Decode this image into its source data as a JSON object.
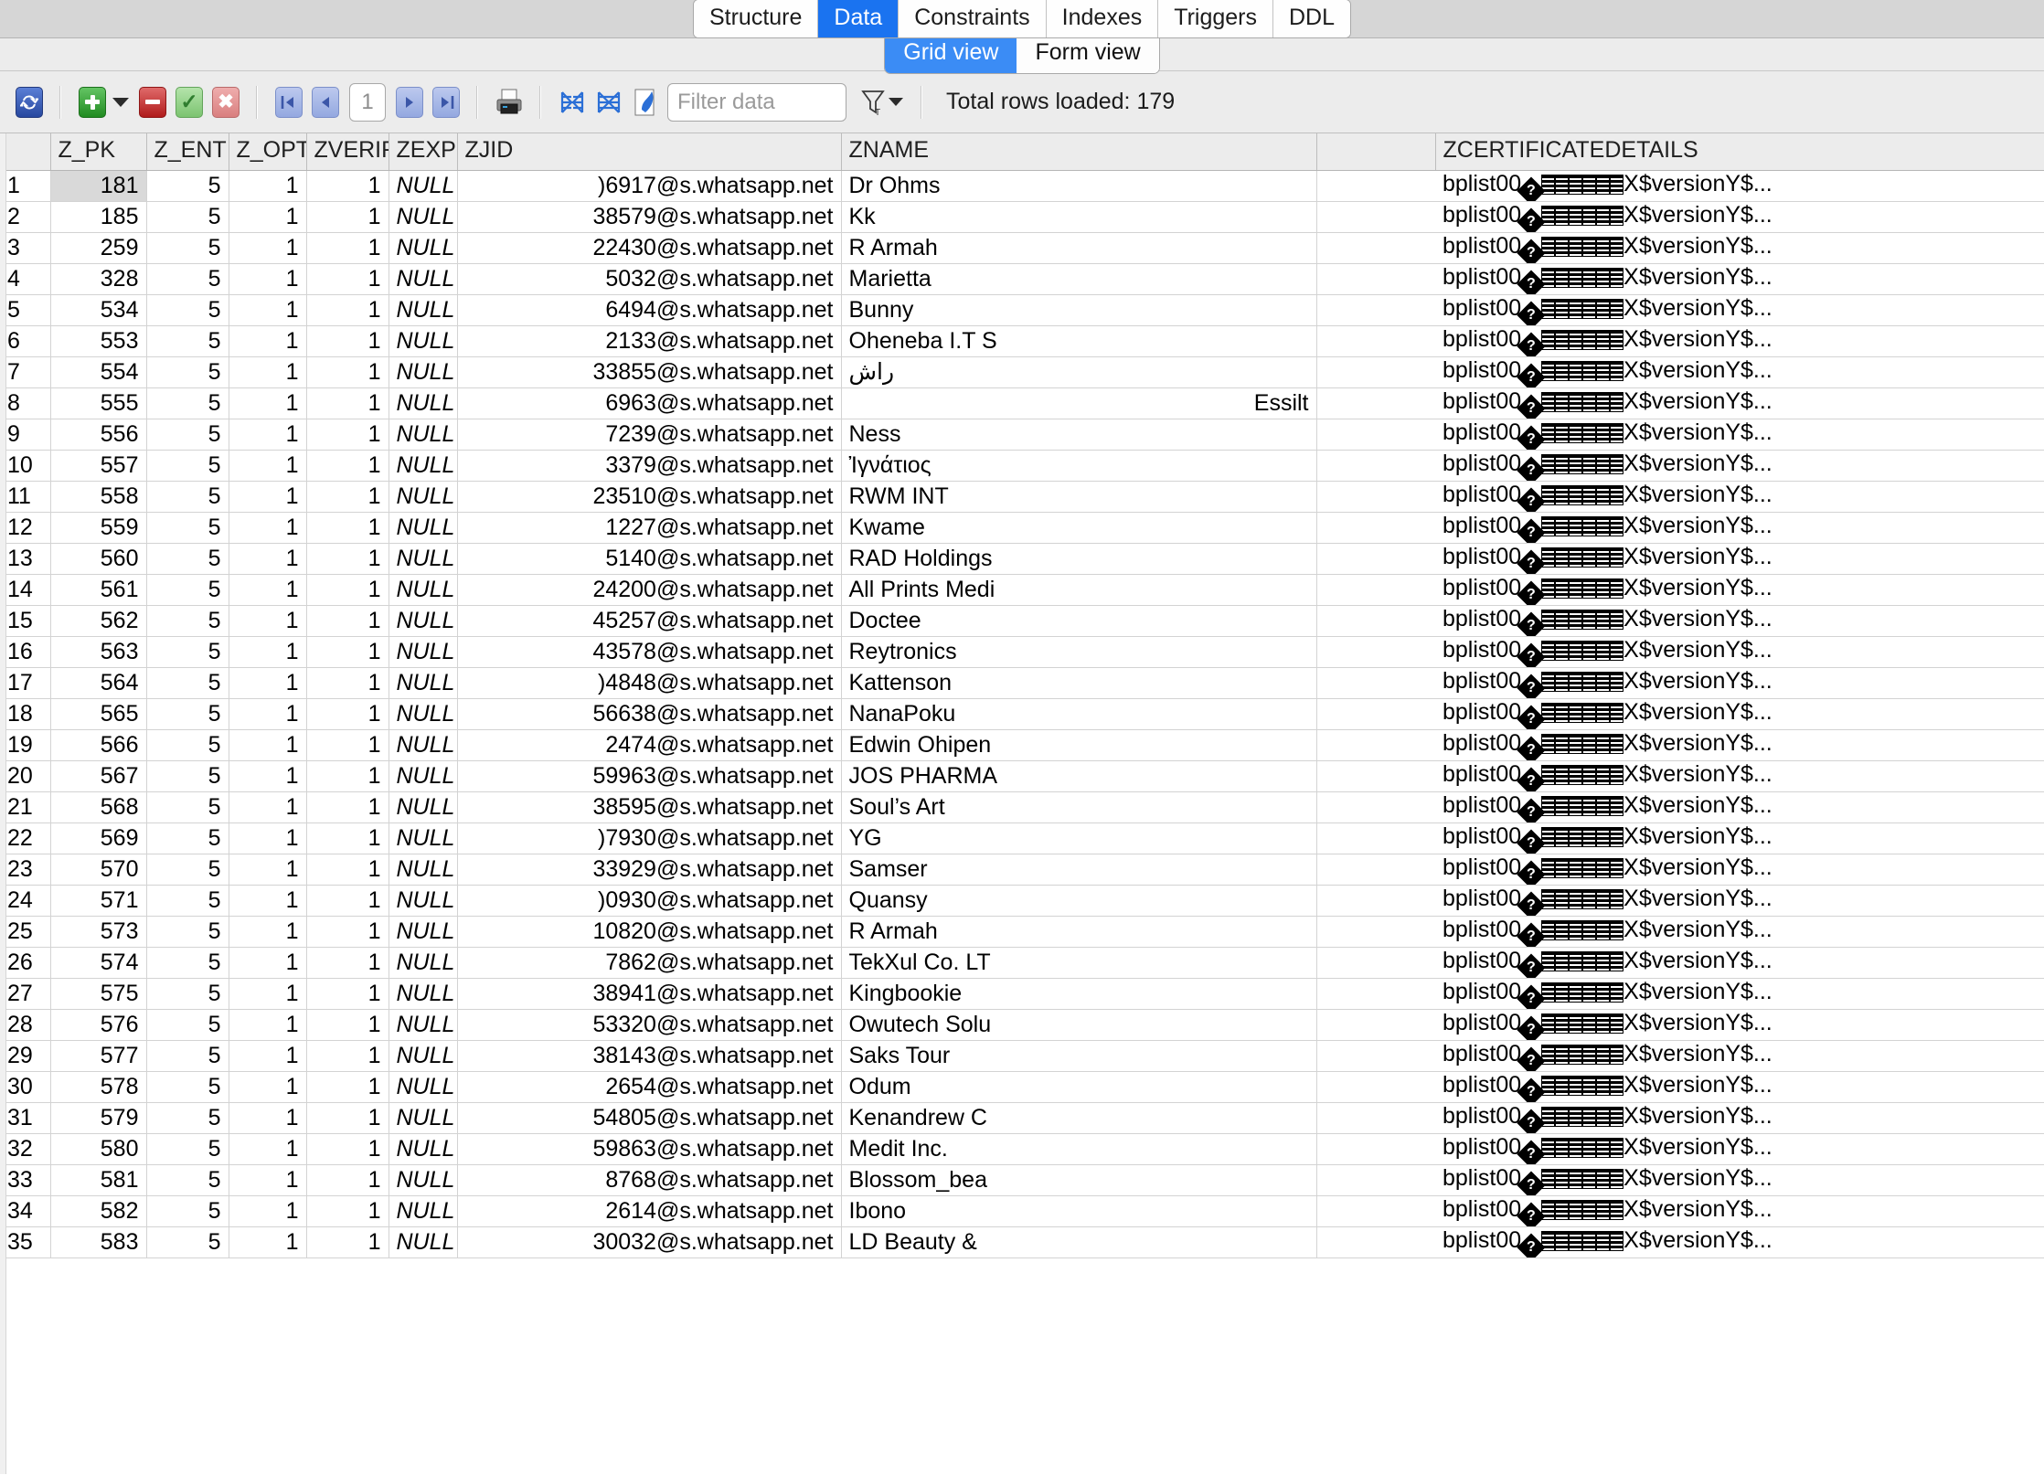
{
  "tabs": {
    "items": [
      {
        "label": "Structure",
        "active": false
      },
      {
        "label": "Data",
        "active": true
      },
      {
        "label": "Constraints",
        "active": false
      },
      {
        "label": "Indexes",
        "active": false
      },
      {
        "label": "Triggers",
        "active": false
      },
      {
        "label": "DDL",
        "active": false
      }
    ]
  },
  "view_switch": {
    "grid_label": "Grid view",
    "form_label": "Form view",
    "active": "Grid view"
  },
  "toolbar": {
    "refresh_icon": "refresh-icon",
    "add_icon": "add-record-icon",
    "add_dropdown_icon": "chevron-down-icon",
    "delete_icon": "delete-record-icon",
    "commit_icon": "commit-checkmark-icon",
    "rollback_icon": "rollback-x-icon",
    "first_page_icon": "first-page-icon",
    "prev_page_icon": "previous-page-icon",
    "page_value": "1",
    "next_page_icon": "next-page-icon",
    "last_page_icon": "last-page-icon",
    "print_icon": "print-icon",
    "collapse_icon": "collapse-columns-icon",
    "expand_icon": "expand-columns-icon",
    "paint_icon": "color-format-icon",
    "filter_placeholder": "Filter data",
    "filter_value": "",
    "filter_type_icon": "filter-funnel-icon",
    "filter_dropdown_icon": "chevron-down-icon",
    "total_rows_label": "Total rows loaded: 179"
  },
  "grid": {
    "columns": [
      "Z_PK",
      "Z_ENT",
      "Z_OPT",
      "ZVERIFIC",
      "ZEXPIRE",
      "ZJID",
      "ZNAME",
      "ZCERTIFICATEDETAILS"
    ],
    "cert_prefix": "bplist00",
    "cert_suffix": "X$versionY$...",
    "null_text": "NULL",
    "rows": [
      {
        "n": "1",
        "pk": "181",
        "ent": "5",
        "opt": "1",
        "verif": "1",
        "expire": "NULL",
        "jid": ")6917@s.whatsapp.net",
        "name": "Dr Ohms",
        "rtl": false
      },
      {
        "n": "2",
        "pk": "185",
        "ent": "5",
        "opt": "1",
        "verif": "1",
        "expire": "NULL",
        "jid": "38579@s.whatsapp.net",
        "name": "Kk",
        "rtl": false
      },
      {
        "n": "3",
        "pk": "259",
        "ent": "5",
        "opt": "1",
        "verif": "1",
        "expire": "NULL",
        "jid": "22430@s.whatsapp.net",
        "name": "R Armah",
        "rtl": false
      },
      {
        "n": "4",
        "pk": "328",
        "ent": "5",
        "opt": "1",
        "verif": "1",
        "expire": "NULL",
        "jid": "5032@s.whatsapp.net",
        "name": "Marietta",
        "rtl": false
      },
      {
        "n": "5",
        "pk": "534",
        "ent": "5",
        "opt": "1",
        "verif": "1",
        "expire": "NULL",
        "jid": "6494@s.whatsapp.net",
        "name": "Bunny",
        "rtl": false
      },
      {
        "n": "6",
        "pk": "553",
        "ent": "5",
        "opt": "1",
        "verif": "1",
        "expire": "NULL",
        "jid": "2133@s.whatsapp.net",
        "name": "Oheneba I.T S",
        "rtl": false
      },
      {
        "n": "7",
        "pk": "554",
        "ent": "5",
        "opt": "1",
        "verif": "1",
        "expire": "NULL",
        "jid": "33855@s.whatsapp.net",
        "name": "راش",
        "rtl": false
      },
      {
        "n": "8",
        "pk": "555",
        "ent": "5",
        "opt": "1",
        "verif": "1",
        "expire": "NULL",
        "jid": "6963@s.whatsapp.net",
        "name": "Essilt",
        "rtl": true
      },
      {
        "n": "9",
        "pk": "556",
        "ent": "5",
        "opt": "1",
        "verif": "1",
        "expire": "NULL",
        "jid": "7239@s.whatsapp.net",
        "name": "Ness",
        "rtl": false
      },
      {
        "n": "10",
        "pk": "557",
        "ent": "5",
        "opt": "1",
        "verif": "1",
        "expire": "NULL",
        "jid": "3379@s.whatsapp.net",
        "name": "Ἰγνάτιος",
        "rtl": false
      },
      {
        "n": "11",
        "pk": "558",
        "ent": "5",
        "opt": "1",
        "verif": "1",
        "expire": "NULL",
        "jid": "23510@s.whatsapp.net",
        "name": "RWM INT",
        "rtl": false
      },
      {
        "n": "12",
        "pk": "559",
        "ent": "5",
        "opt": "1",
        "verif": "1",
        "expire": "NULL",
        "jid": "1227@s.whatsapp.net",
        "name": "Kwame",
        "rtl": false
      },
      {
        "n": "13",
        "pk": "560",
        "ent": "5",
        "opt": "1",
        "verif": "1",
        "expire": "NULL",
        "jid": "5140@s.whatsapp.net",
        "name": "RAD Holdings",
        "rtl": false
      },
      {
        "n": "14",
        "pk": "561",
        "ent": "5",
        "opt": "1",
        "verif": "1",
        "expire": "NULL",
        "jid": "24200@s.whatsapp.net",
        "name": "All Prints Medi",
        "rtl": false
      },
      {
        "n": "15",
        "pk": "562",
        "ent": "5",
        "opt": "1",
        "verif": "1",
        "expire": "NULL",
        "jid": "45257@s.whatsapp.net",
        "name": "Doctee",
        "rtl": false
      },
      {
        "n": "16",
        "pk": "563",
        "ent": "5",
        "opt": "1",
        "verif": "1",
        "expire": "NULL",
        "jid": "43578@s.whatsapp.net",
        "name": "Reytronics",
        "rtl": false
      },
      {
        "n": "17",
        "pk": "564",
        "ent": "5",
        "opt": "1",
        "verif": "1",
        "expire": "NULL",
        "jid": ")4848@s.whatsapp.net",
        "name": "Kattenson",
        "rtl": false
      },
      {
        "n": "18",
        "pk": "565",
        "ent": "5",
        "opt": "1",
        "verif": "1",
        "expire": "NULL",
        "jid": "56638@s.whatsapp.net",
        "name": "NanaPoku",
        "rtl": false
      },
      {
        "n": "19",
        "pk": "566",
        "ent": "5",
        "opt": "1",
        "verif": "1",
        "expire": "NULL",
        "jid": "2474@s.whatsapp.net",
        "name": "Edwin Ohipen",
        "rtl": false
      },
      {
        "n": "20",
        "pk": "567",
        "ent": "5",
        "opt": "1",
        "verif": "1",
        "expire": "NULL",
        "jid": "59963@s.whatsapp.net",
        "name": "JOS PHARMA",
        "rtl": false
      },
      {
        "n": "21",
        "pk": "568",
        "ent": "5",
        "opt": "1",
        "verif": "1",
        "expire": "NULL",
        "jid": "38595@s.whatsapp.net",
        "name": "Soul’s Art",
        "rtl": false
      },
      {
        "n": "22",
        "pk": "569",
        "ent": "5",
        "opt": "1",
        "verif": "1",
        "expire": "NULL",
        "jid": ")7930@s.whatsapp.net",
        "name": "YG",
        "rtl": false
      },
      {
        "n": "23",
        "pk": "570",
        "ent": "5",
        "opt": "1",
        "verif": "1",
        "expire": "NULL",
        "jid": "33929@s.whatsapp.net",
        "name": "Samser",
        "rtl": false
      },
      {
        "n": "24",
        "pk": "571",
        "ent": "5",
        "opt": "1",
        "verif": "1",
        "expire": "NULL",
        "jid": ")0930@s.whatsapp.net",
        "name": "Quansy",
        "rtl": false
      },
      {
        "n": "25",
        "pk": "573",
        "ent": "5",
        "opt": "1",
        "verif": "1",
        "expire": "NULL",
        "jid": "10820@s.whatsapp.net",
        "name": "R Armah",
        "rtl": false
      },
      {
        "n": "26",
        "pk": "574",
        "ent": "5",
        "opt": "1",
        "verif": "1",
        "expire": "NULL",
        "jid": "7862@s.whatsapp.net",
        "name": "TekXul Co. LT",
        "rtl": false
      },
      {
        "n": "27",
        "pk": "575",
        "ent": "5",
        "opt": "1",
        "verif": "1",
        "expire": "NULL",
        "jid": "38941@s.whatsapp.net",
        "name": "Kingbookie",
        "rtl": false
      },
      {
        "n": "28",
        "pk": "576",
        "ent": "5",
        "opt": "1",
        "verif": "1",
        "expire": "NULL",
        "jid": "53320@s.whatsapp.net",
        "name": "Owutech Solu",
        "rtl": false
      },
      {
        "n": "29",
        "pk": "577",
        "ent": "5",
        "opt": "1",
        "verif": "1",
        "expire": "NULL",
        "jid": "38143@s.whatsapp.net",
        "name": "Saks Tour",
        "rtl": false
      },
      {
        "n": "30",
        "pk": "578",
        "ent": "5",
        "opt": "1",
        "verif": "1",
        "expire": "NULL",
        "jid": "2654@s.whatsapp.net",
        "name": "Odum",
        "rtl": false
      },
      {
        "n": "31",
        "pk": "579",
        "ent": "5",
        "opt": "1",
        "verif": "1",
        "expire": "NULL",
        "jid": "54805@s.whatsapp.net",
        "name": "Kenandrew C",
        "rtl": false
      },
      {
        "n": "32",
        "pk": "580",
        "ent": "5",
        "opt": "1",
        "verif": "1",
        "expire": "NULL",
        "jid": "59863@s.whatsapp.net",
        "name": "Medit Inc.",
        "rtl": false
      },
      {
        "n": "33",
        "pk": "581",
        "ent": "5",
        "opt": "1",
        "verif": "1",
        "expire": "NULL",
        "jid": "8768@s.whatsapp.net",
        "name": "Blossom_bea",
        "rtl": false
      },
      {
        "n": "34",
        "pk": "582",
        "ent": "5",
        "opt": "1",
        "verif": "1",
        "expire": "NULL",
        "jid": "2614@s.whatsapp.net",
        "name": "Ibono",
        "rtl": false
      },
      {
        "n": "35",
        "pk": "583",
        "ent": "5",
        "opt": "1",
        "verif": "1",
        "expire": "NULL",
        "jid": "30032@s.whatsapp.net",
        "name": "LD Beauty &",
        "rtl": false
      }
    ]
  },
  "colors": {
    "accent": "#1a73f0",
    "toolbar_bg": "#ececec",
    "tabbar_bg": "#d6d6d6",
    "header_bg": "#ececec",
    "selected_cell": "#d9d9d9"
  }
}
